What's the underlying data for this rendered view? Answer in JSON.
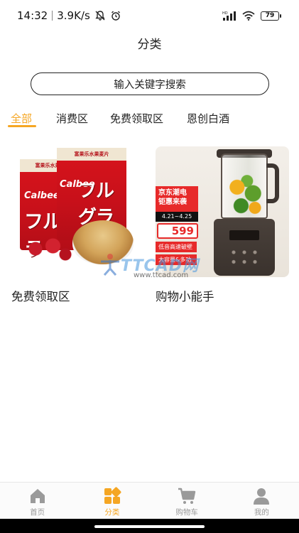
{
  "status_bar": {
    "time": "14:32",
    "speed": "3.9K/s",
    "battery": "79",
    "network": "HD"
  },
  "page": {
    "title": "分类"
  },
  "search": {
    "placeholder": "输入关键字搜索"
  },
  "tabs": [
    {
      "label": "全部",
      "active": true
    },
    {
      "label": "消费区",
      "active": false
    },
    {
      "label": "免费领取区",
      "active": false
    },
    {
      "label": "恩创白酒",
      "active": false
    }
  ],
  "cards": [
    {
      "label": "免费领取区",
      "image": {
        "icon": "cereal-product-image",
        "top_strip": "富果乐水果麦片",
        "brand": "Calbee",
        "big_text": "フルグラ"
      }
    },
    {
      "label": "购物小能手",
      "image": {
        "icon": "blender-product-image",
        "promo": "京东潮电 钜惠来袭",
        "date": "4.21~4.25",
        "price": "599",
        "features": [
          "低音高速破壁",
          "大容量&多功能"
        ]
      }
    }
  ],
  "watermark": {
    "main": "TTCAD网",
    "sub": "www.ttcad.com"
  },
  "bottom_nav": [
    {
      "label": "首页",
      "icon": "home-icon",
      "active": false
    },
    {
      "label": "分类",
      "icon": "category-icon",
      "active": true
    },
    {
      "label": "购物车",
      "icon": "cart-icon",
      "active": false
    },
    {
      "label": "我的",
      "icon": "user-icon",
      "active": false
    }
  ],
  "colors": {
    "accent": "#f5a623",
    "inactive": "#999999",
    "text": "#222222"
  }
}
